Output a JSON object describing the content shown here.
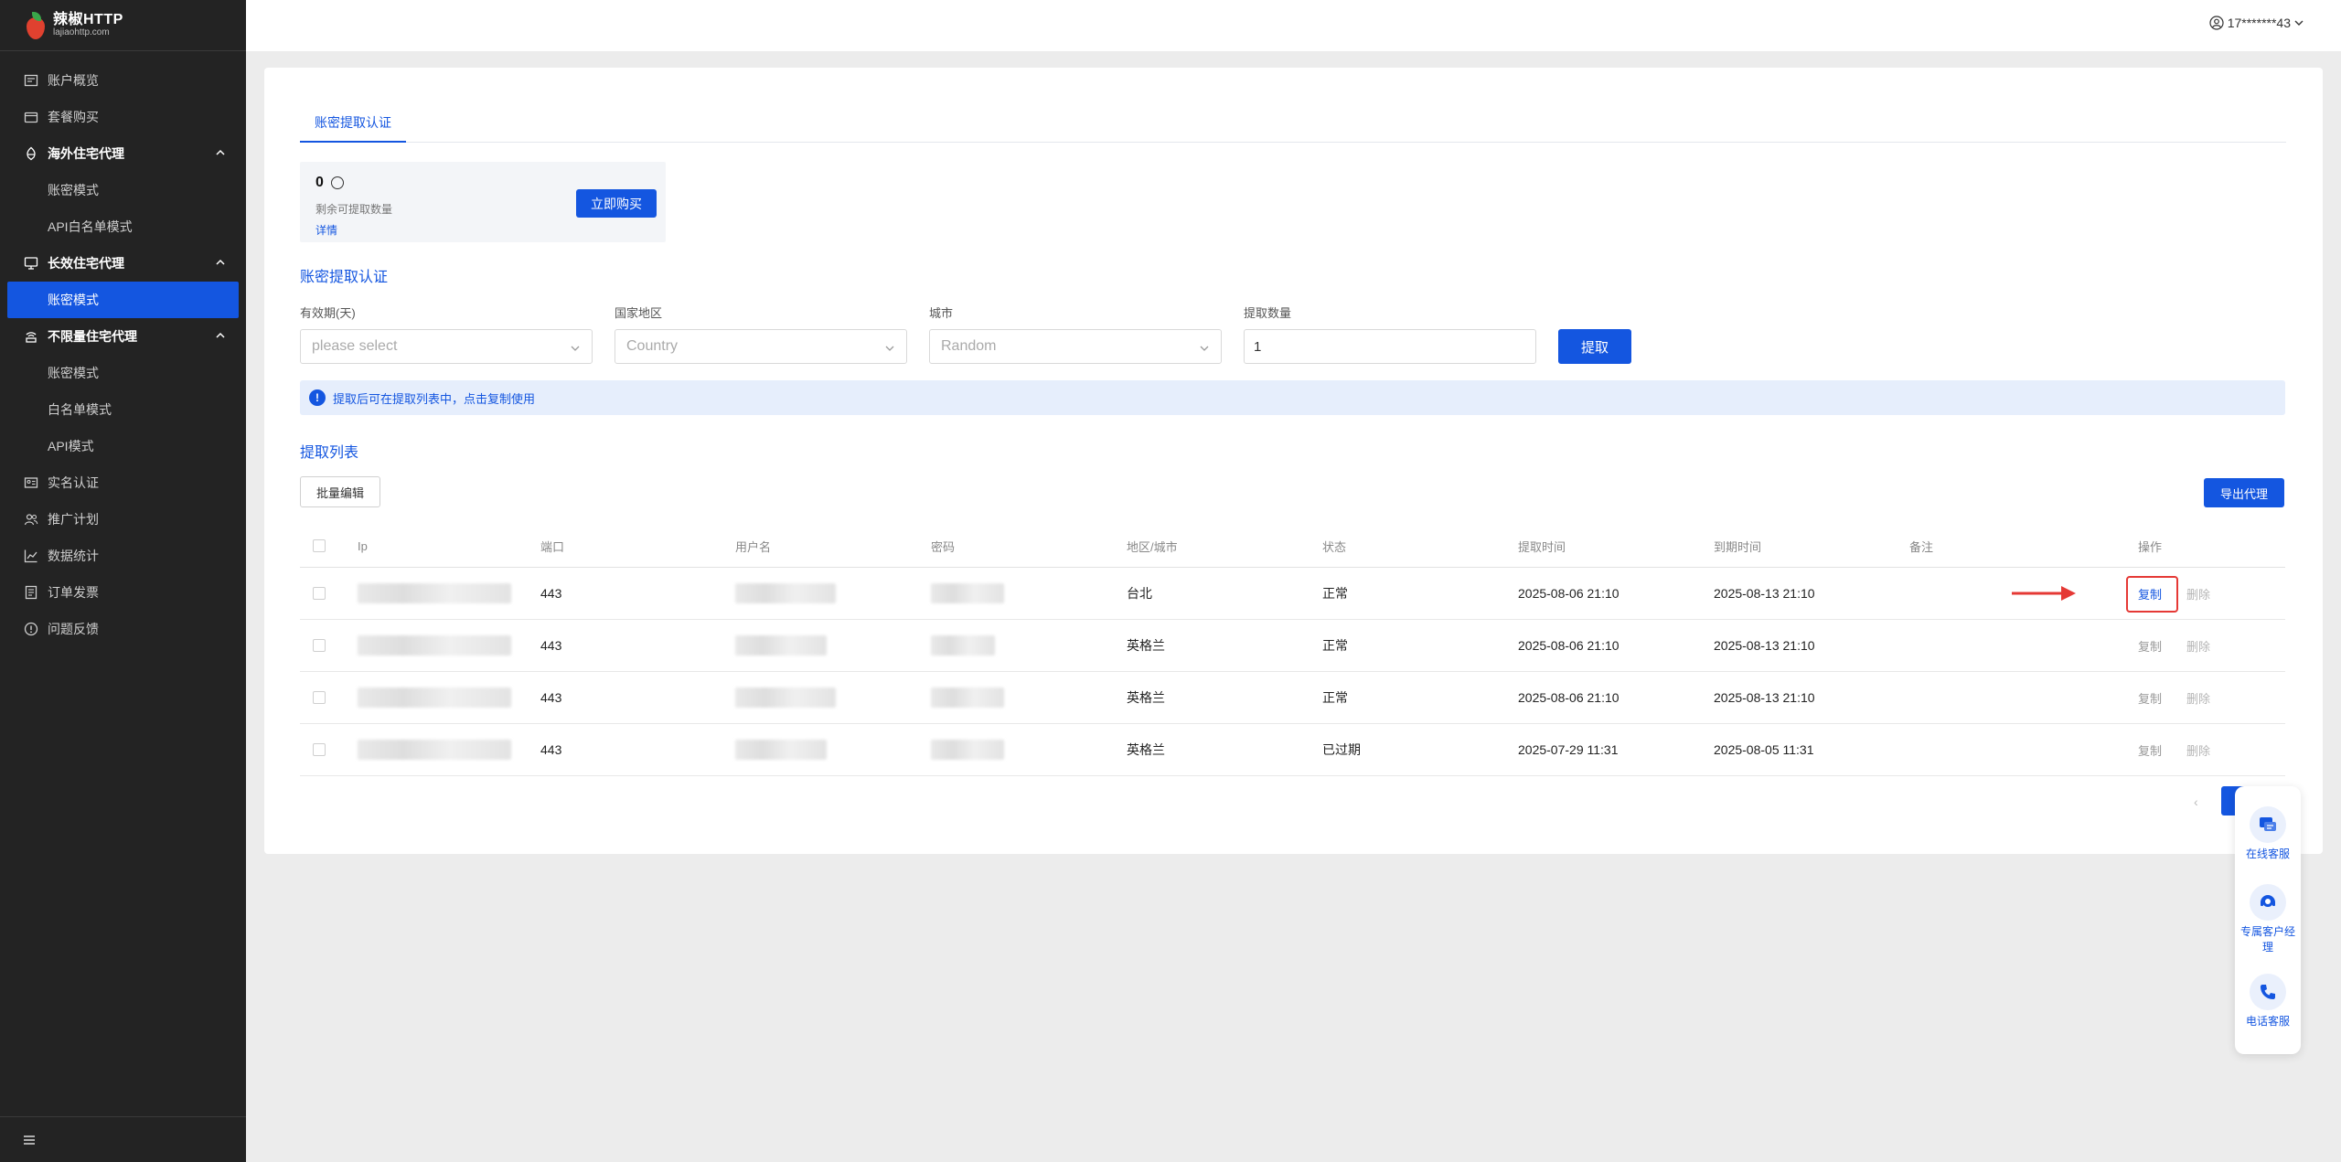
{
  "brand": {
    "name": "辣椒HTTP",
    "domain": "lajiaohttp.com"
  },
  "header": {
    "user": "17*******43"
  },
  "sidebar": {
    "items": [
      {
        "label": "账户概览",
        "icon": "dashboard-icon"
      },
      {
        "label": "套餐购买",
        "icon": "wallet-icon"
      },
      {
        "label": "海外住宅代理",
        "icon": "globe-icon",
        "group": true
      },
      {
        "label": "账密模式",
        "sub": true
      },
      {
        "label": "API白名单模式",
        "sub": true
      },
      {
        "label": "长效住宅代理",
        "icon": "monitor-icon",
        "group": true
      },
      {
        "label": "账密模式",
        "sub": true,
        "active": true
      },
      {
        "label": "不限量住宅代理",
        "icon": "router-icon",
        "group": true
      },
      {
        "label": "账密模式",
        "sub": true
      },
      {
        "label": "白名单模式",
        "sub": true
      },
      {
        "label": "API模式",
        "sub": true
      },
      {
        "label": "实名认证",
        "icon": "id-card-icon"
      },
      {
        "label": "推广计划",
        "icon": "users-icon"
      },
      {
        "label": "数据统计",
        "icon": "chart-icon"
      },
      {
        "label": "订单发票",
        "icon": "invoice-icon"
      },
      {
        "label": "问题反馈",
        "icon": "feedback-icon"
      }
    ]
  },
  "tabs": {
    "active": "账密提取认证"
  },
  "balance": {
    "count": "0",
    "label": "剩余可提取数量",
    "detail": "详情",
    "buy": "立即购买"
  },
  "form": {
    "title": "账密提取认证",
    "validity_label": "有效期(天)",
    "validity_placeholder": "please select",
    "country_label": "国家地区",
    "country_placeholder": "Country",
    "city_label": "城市",
    "city_placeholder": "Random",
    "qty_label": "提取数量",
    "qty_value": "1",
    "submit": "提取"
  },
  "alert": {
    "text": "提取后可在提取列表中，点击复制使用"
  },
  "list": {
    "title": "提取列表",
    "batch_edit": "批量编辑",
    "export": "导出代理",
    "columns": [
      "Ip",
      "端口",
      "用户名",
      "密码",
      "地区/城市",
      "状态",
      "提取时间",
      "到期时间",
      "备注",
      "操作"
    ],
    "rows": [
      {
        "port": "443",
        "region": "台北",
        "status": "正常",
        "extracted": "2025-08-06 21:10",
        "expires": "2025-08-13 21:10",
        "note": "",
        "copy": "复制",
        "delete": "删除"
      },
      {
        "port": "443",
        "region": "英格兰",
        "status": "正常",
        "extracted": "2025-08-06 21:10",
        "expires": "2025-08-13 21:10",
        "note": "",
        "copy": "复制",
        "delete": "删除"
      },
      {
        "port": "443",
        "region": "英格兰",
        "status": "正常",
        "extracted": "2025-08-06 21:10",
        "expires": "2025-08-13 21:10",
        "note": "",
        "copy": "复制",
        "delete": "删除"
      },
      {
        "port": "443",
        "region": "英格兰",
        "status": "已过期",
        "extracted": "2025-07-29 11:31",
        "expires": "2025-08-05 11:31",
        "note": "",
        "copy": "复制",
        "delete": "删除"
      }
    ]
  },
  "float": {
    "online": "在线客服",
    "manager": "专属客户经理",
    "phone": "电话客服"
  },
  "colors": {
    "primary": "#1456e0",
    "sidebar": "#232323",
    "highlight": "#e53935"
  }
}
